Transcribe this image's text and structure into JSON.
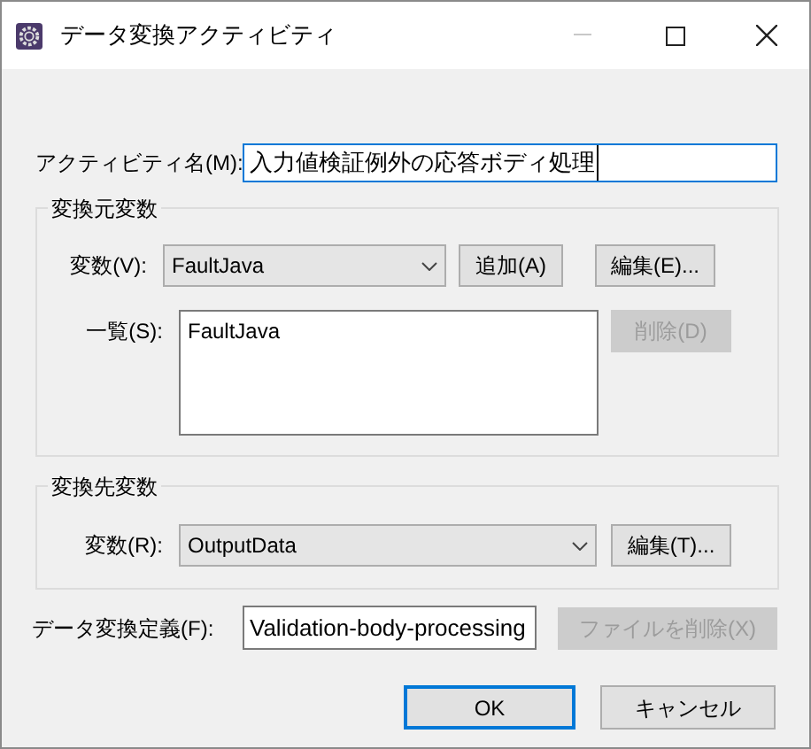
{
  "window": {
    "title": "データ変換アクティビティ"
  },
  "activity_name": {
    "label": "アクティビティ名(M):",
    "value": "入力値検証例外の応答ボディ処理"
  },
  "source_group": {
    "title": "変換元変数",
    "variable": {
      "label": "変数(V):",
      "value": "FaultJava"
    },
    "add_button": {
      "label": "追加(A)",
      "disabled": false
    },
    "edit_button": {
      "label": "編集(E)...",
      "disabled": false
    },
    "list": {
      "label": "一覧(S):",
      "items": [
        "FaultJava"
      ]
    },
    "delete_button": {
      "label": "削除(D)",
      "disabled": true
    }
  },
  "target_group": {
    "title": "変換先変数",
    "variable": {
      "label": "変数(R):",
      "value": "OutputData"
    },
    "edit_button": {
      "label": "編集(T)...",
      "disabled": false
    }
  },
  "definition": {
    "label": "データ変換定義(F):",
    "value": "Validation-body-processing",
    "delete_file_button": {
      "label": "ファイルを削除(X)",
      "disabled": true
    }
  },
  "buttons": [
    {
      "label": "OK",
      "default": true
    },
    {
      "label": "キャンセル",
      "default": false
    }
  ]
}
